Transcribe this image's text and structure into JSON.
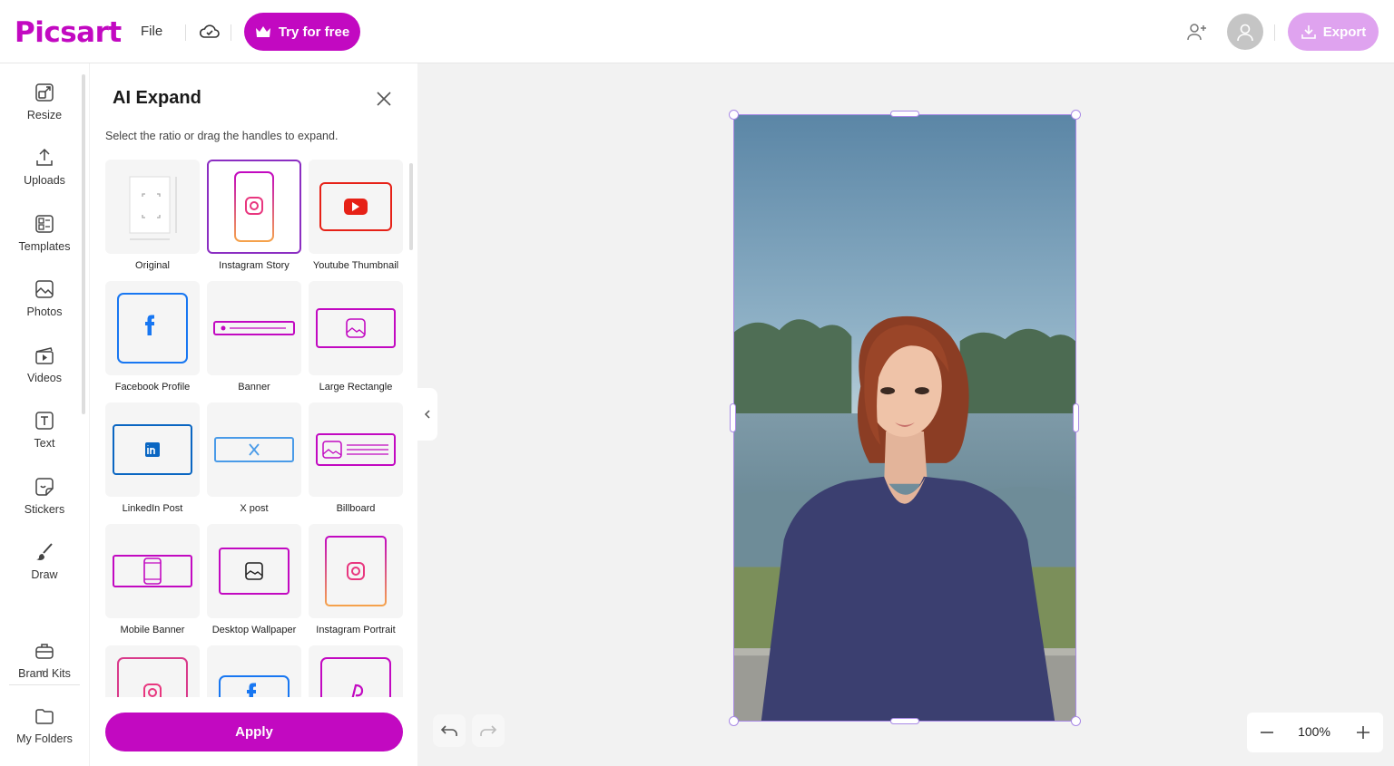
{
  "header": {
    "logo": "Picsart",
    "file_label": "File",
    "try_label": "Try for free",
    "export_label": "Export"
  },
  "colors": {
    "brand": "#c209c1",
    "selection": "#a98ae6",
    "export_bg": "#dfa3ef"
  },
  "rail": {
    "items": [
      {
        "label": "Resize",
        "icon": "resize-icon"
      },
      {
        "label": "Uploads",
        "icon": "upload-icon"
      },
      {
        "label": "Templates",
        "icon": "templates-icon"
      },
      {
        "label": "Photos",
        "icon": "photo-icon"
      },
      {
        "label": "Videos",
        "icon": "video-icon"
      },
      {
        "label": "Text",
        "icon": "text-icon"
      },
      {
        "label": "Stickers",
        "icon": "sticker-icon"
      },
      {
        "label": "Draw",
        "icon": "brush-icon"
      },
      {
        "label": "Brand Kits",
        "icon": "briefcase-icon"
      },
      {
        "label": "My Folders",
        "icon": "folder-icon"
      }
    ],
    "collapse_caret": "^"
  },
  "panel": {
    "title": "AI Expand",
    "subtitle": "Select the ratio or drag the handles to expand.",
    "apply_label": "Apply",
    "selected": "Instagram Story",
    "ratios": [
      {
        "label": "Original",
        "icon": "original-icon"
      },
      {
        "label": "Instagram Story",
        "icon": "instagram-icon"
      },
      {
        "label": "Youtube Thumbnail",
        "icon": "youtube-icon"
      },
      {
        "label": "Facebook Profile",
        "icon": "facebook-icon"
      },
      {
        "label": "Banner",
        "icon": "banner-icon"
      },
      {
        "label": "Large Rectangle",
        "icon": "image-icon"
      },
      {
        "label": "LinkedIn Post",
        "icon": "linkedin-icon"
      },
      {
        "label": "X post",
        "icon": "x-icon"
      },
      {
        "label": "Billboard",
        "icon": "billboard-icon"
      },
      {
        "label": "Mobile Banner",
        "icon": "mobile-icon"
      },
      {
        "label": "Desktop Wallpaper",
        "icon": "image-icon"
      },
      {
        "label": "Instagram Portrait",
        "icon": "instagram-icon"
      },
      {
        "label": "",
        "icon": "instagram-icon"
      },
      {
        "label": "",
        "icon": "facebook-icon"
      },
      {
        "label": "",
        "icon": "pinterest-icon"
      }
    ]
  },
  "zoom": {
    "value": "100%"
  }
}
